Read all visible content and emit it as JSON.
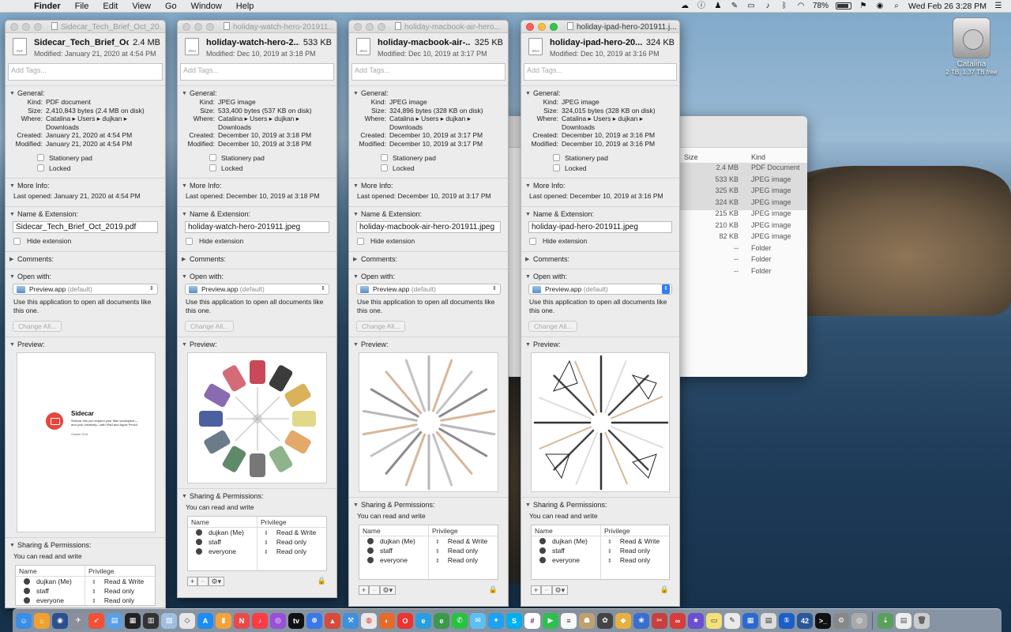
{
  "menubar": {
    "apple": "",
    "items": [
      "Finder",
      "File",
      "Edit",
      "View",
      "Go",
      "Window",
      "Help"
    ],
    "battery": "78%",
    "clock": "Wed Feb 26  3:28 PM"
  },
  "desktop": {
    "drive_name": "Catalina",
    "drive_space": "2 TB, 1.37 TB free"
  },
  "finder": {
    "size_header": "Size",
    "kind_header": "Kind",
    "rows": [
      {
        "size": "2.4 MB",
        "kind": "PDF Document"
      },
      {
        "size": "533 KB",
        "kind": "JPEG image"
      },
      {
        "size": "325 KB",
        "kind": "JPEG image"
      },
      {
        "size": "324 KB",
        "kind": "JPEG image"
      },
      {
        "size": "215 KB",
        "kind": "JPEG image"
      },
      {
        "size": "210 KB",
        "kind": "JPEG image"
      },
      {
        "size": "82 KB",
        "kind": "JPEG image"
      },
      {
        "size": "--",
        "kind": "Folder"
      },
      {
        "size": "--",
        "kind": "Folder"
      },
      {
        "size": "--",
        "kind": "Folder"
      }
    ]
  },
  "labels": {
    "tags_placeholder": "Add Tags...",
    "general": "General:",
    "kind": "Kind:",
    "size": "Size:",
    "where": "Where:",
    "created": "Created:",
    "modified": "Modified:",
    "stationery": "Stationery pad",
    "locked": "Locked",
    "more_info": "More Info:",
    "name_ext": "Name & Extension:",
    "hide_ext": "Hide extension",
    "comments": "Comments:",
    "open_with": "Open with:",
    "default": "(default)",
    "use_app": "Use this application to open all documents like this one.",
    "change_all": "Change All...",
    "preview": "Preview:",
    "sharing": "Sharing & Permissions:",
    "can_read_write": "You can read and write",
    "col_name": "Name",
    "col_priv": "Privilege",
    "where_path": "Catalina ▸ Users ▸ dujkan ▸ Downloads",
    "app_name": "Preview.app"
  },
  "permissions": [
    {
      "name": "dujkan (Me)",
      "priv": "Read & Write"
    },
    {
      "name": "staff",
      "priv": "Read only"
    },
    {
      "name": "everyone",
      "priv": "Read only"
    }
  ],
  "windows": [
    {
      "title": "Sidecar_Tech_Brief_Oct_20...",
      "header_name": "Sidecar_Tech_Brief_Oc...",
      "header_size": "2.4 MB",
      "modified_line": "Modified: January 21, 2020 at 4:54 PM",
      "kind": "PDF document",
      "size": "2,410,843 bytes (2.4 MB on disk)",
      "created": "January 21, 2020 at 4:54 PM",
      "modified": "January 21, 2020 at 4:54 PM",
      "last_opened": "Last opened: January 21, 2020 at 4:54 PM",
      "filename": "Sidecar_Tech_Brief_Oct_2019.pdf",
      "icon_label": "PDF"
    },
    {
      "title": "holiday-watch-hero-201911...",
      "header_name": "holiday-watch-hero-2...",
      "header_size": "533 KB",
      "modified_line": "Modified: Dec 10, 2019 at 3:18 PM",
      "kind": "JPEG image",
      "size": "533,400 bytes (537 KB on disk)",
      "created": "December 10, 2019 at 3:18 PM",
      "modified": "December 10, 2019 at 3:18 PM",
      "last_opened": "Last opened: December 10, 2019 at 3:18 PM",
      "filename": "holiday-watch-hero-201911.jpeg",
      "icon_label": "JPEG"
    },
    {
      "title": "holiday-macbook-air-hero...",
      "header_name": "holiday-macbook-air-...",
      "header_size": "325 KB",
      "modified_line": "Modified: Dec 10, 2019 at 3:17 PM",
      "kind": "JPEG image",
      "size": "324,896 bytes (328 KB on disk)",
      "created": "December 10, 2019 at 3:17 PM",
      "modified": "December 10, 2019 at 3:17 PM",
      "last_opened": "Last opened: December 10, 2019 at 3:17 PM",
      "filename": "holiday-macbook-air-hero-201911.jpeg",
      "icon_label": "JPEG"
    },
    {
      "title": "holiday-ipad-hero-201911.j...",
      "header_name": "holiday-ipad-hero-20...",
      "header_size": "324 KB",
      "modified_line": "Modified: Dec 10, 2019 at 3:16 PM",
      "kind": "JPEG image",
      "size": "324,015 bytes (328 KB on disk)",
      "created": "December 10, 2019 at 3:16 PM",
      "modified": "December 10, 2019 at 3:16 PM",
      "last_opened": "Last opened: December 10, 2019 at 3:16 PM",
      "filename": "holiday-ipad-hero-201911.jpeg",
      "icon_label": "JPEG"
    }
  ],
  "sidecar_preview": {
    "apple": "",
    "title": "Sidecar",
    "text": "Sidecar lets you expand your Mac workspace—and your creativity—with iPad and Apple Pencil.",
    "date": "October 2019"
  },
  "dock_badge": "42"
}
